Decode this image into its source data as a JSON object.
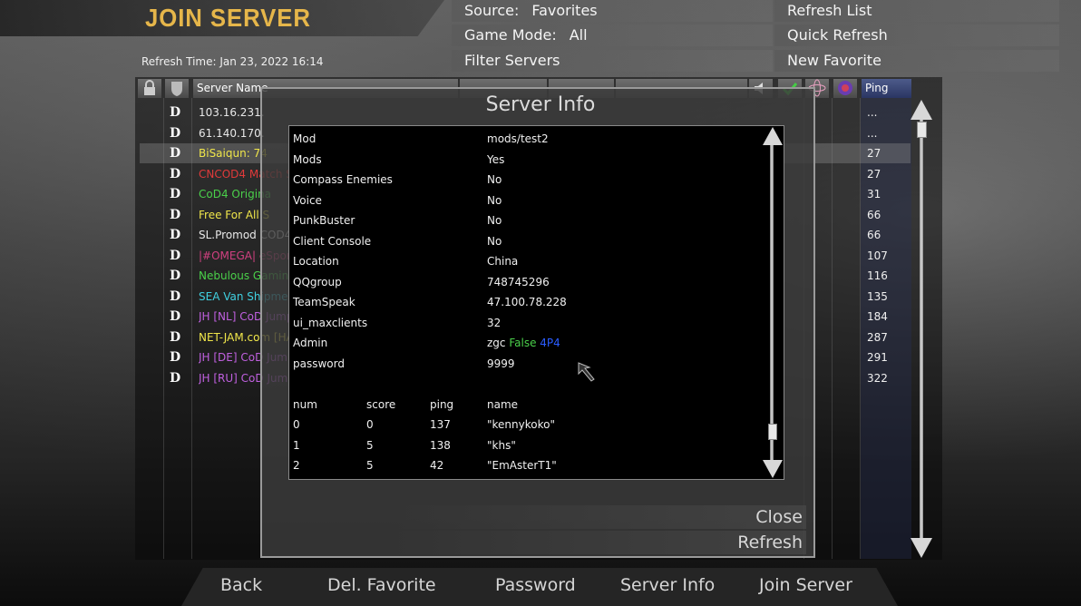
{
  "title": "JOIN SERVER",
  "refresh_time": "Refresh Time: Jan 23, 2022  16:14",
  "source": {
    "label": "Source:",
    "value": "Favorites"
  },
  "game_mode": {
    "label": "Game Mode:",
    "value": "All"
  },
  "filter_servers": "Filter Servers",
  "right_menu": {
    "refresh_list": "Refresh List",
    "quick_refresh": "Quick Refresh",
    "new_favorite": "New Favorite"
  },
  "columns": {
    "server_name": "Server Name",
    "ping": "Ping"
  },
  "servers": [
    {
      "d": "D",
      "name": "103.16.231.",
      "ping": "..."
    },
    {
      "d": "D",
      "name": "61.140.170.",
      "ping": "..."
    },
    {
      "d": "D",
      "name": "BiSaiqun: 74",
      "ping": "27"
    },
    {
      "d": "D",
      "name": "CNCOD4 Match Se",
      "ping": "27"
    },
    {
      "d": "D",
      "name": "CoD4 Origina",
      "ping": "31"
    },
    {
      "d": "D",
      "name": "Free For All S",
      "ping": "66"
    },
    {
      "d": "D",
      "name": "SL.Promod  COD4",
      "ping": "66"
    },
    {
      "d": "D",
      "name": "|#OMEGA| eSport",
      "ping": "107"
    },
    {
      "d": "D",
      "name": "Nebulous Gaming",
      "ping": "116"
    },
    {
      "d": "D",
      "name": "SEA Van Shipment",
      "ping": "135"
    },
    {
      "d": "D",
      "name": "JH [NL] CoD Jumpe",
      "ping": "184"
    },
    {
      "d": "D",
      "name": "NET-JAM.com [HA",
      "ping": "287"
    },
    {
      "d": "D",
      "name": "JH [DE] CoD Jumpe",
      "ping": "291"
    },
    {
      "d": "D",
      "name": "JH [RU] CoD Jumpe",
      "ping": "322"
    }
  ],
  "server_colors": [
    "#e8e8e8",
    "#e8e8e8",
    "#f0e64a",
    "#e03a3a",
    "#4ad04a",
    "#f0e64a",
    "#e8e8e8",
    "#d04080",
    "#4ad04a",
    "#40d0e0",
    "#c060e0",
    "#f0e64a",
    "#c060e0",
    "#c060e0"
  ],
  "dialog": {
    "title": "Server Info",
    "info": [
      {
        "key": "Mod",
        "value": "mods/test2"
      },
      {
        "key": "Mods",
        "value": "Yes"
      },
      {
        "key": "Compass Enemies",
        "value": "No"
      },
      {
        "key": "Voice",
        "value": "No"
      },
      {
        "key": "PunkBuster",
        "value": "No"
      },
      {
        "key": "Client Console",
        "value": "No"
      },
      {
        "key": "Location",
        "value": "China"
      },
      {
        "key": "QQgroup",
        "value": "748745296"
      },
      {
        "key": "TeamSpeak",
        "value": "47.100.78.228"
      },
      {
        "key": "ui_maxclients",
        "value": "32"
      },
      {
        "key": "Admin",
        "value": "zgc False 4P4"
      },
      {
        "key": "password",
        "value": "9999"
      }
    ],
    "admin_parts": {
      "a": "zgc ",
      "b": "False ",
      "c": "4P4"
    },
    "players_header": {
      "num": "num",
      "score": "score",
      "ping": "ping",
      "name": "name"
    },
    "players": [
      {
        "num": "0",
        "score": "0",
        "ping": "137",
        "name": "\"kennykoko\""
      },
      {
        "num": "1",
        "score": "5",
        "ping": "138",
        "name": "\"khs\""
      },
      {
        "num": "2",
        "score": "5",
        "ping": "42",
        "name": "\"EmAsterT1\""
      }
    ],
    "close": "Close",
    "refresh": "Refresh"
  },
  "bottom": {
    "back": "Back",
    "del_favorite": "Del. Favorite",
    "password": "Password",
    "server_info": "Server Info",
    "join_server": "Join Server"
  }
}
